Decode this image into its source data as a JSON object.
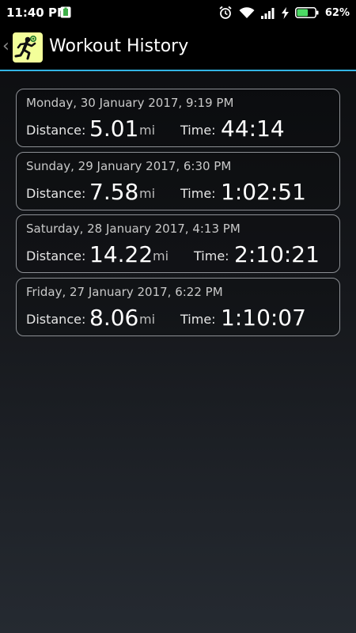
{
  "status_bar": {
    "time": "11:40 PM",
    "notification_icon": "battery-saver-icon",
    "icons": [
      "alarm-icon",
      "wifi-icon",
      "signal-icon",
      "charging-icon",
      "battery-icon"
    ],
    "battery_percent": "62%",
    "battery_level": 0.62,
    "battery_color": "#4cd964"
  },
  "action_bar": {
    "back_glyph": "‹",
    "app_icon": "running-man-icon",
    "title": "Workout History",
    "accent_color": "#33b5e5"
  },
  "workouts": [
    {
      "date": "Monday, 30 January 2017, 9:19 PM",
      "distance_label": "Distance:",
      "distance": "5.01",
      "distance_unit": "mi",
      "time_label": "Time:",
      "time": "44:14"
    },
    {
      "date": "Sunday, 29 January 2017, 6:30 PM",
      "distance_label": "Distance:",
      "distance": "7.58",
      "distance_unit": "mi",
      "time_label": "Time:",
      "time": "1:02:51"
    },
    {
      "date": "Saturday, 28 January 2017, 4:13 PM",
      "distance_label": "Distance:",
      "distance": "14.22",
      "distance_unit": "mi",
      "time_label": "Time:",
      "time": "2:10:21"
    },
    {
      "date": "Friday, 27 January 2017, 6:22 PM",
      "distance_label": "Distance:",
      "distance": "8.06",
      "distance_unit": "mi",
      "time_label": "Time:",
      "time": "1:10:07"
    }
  ]
}
